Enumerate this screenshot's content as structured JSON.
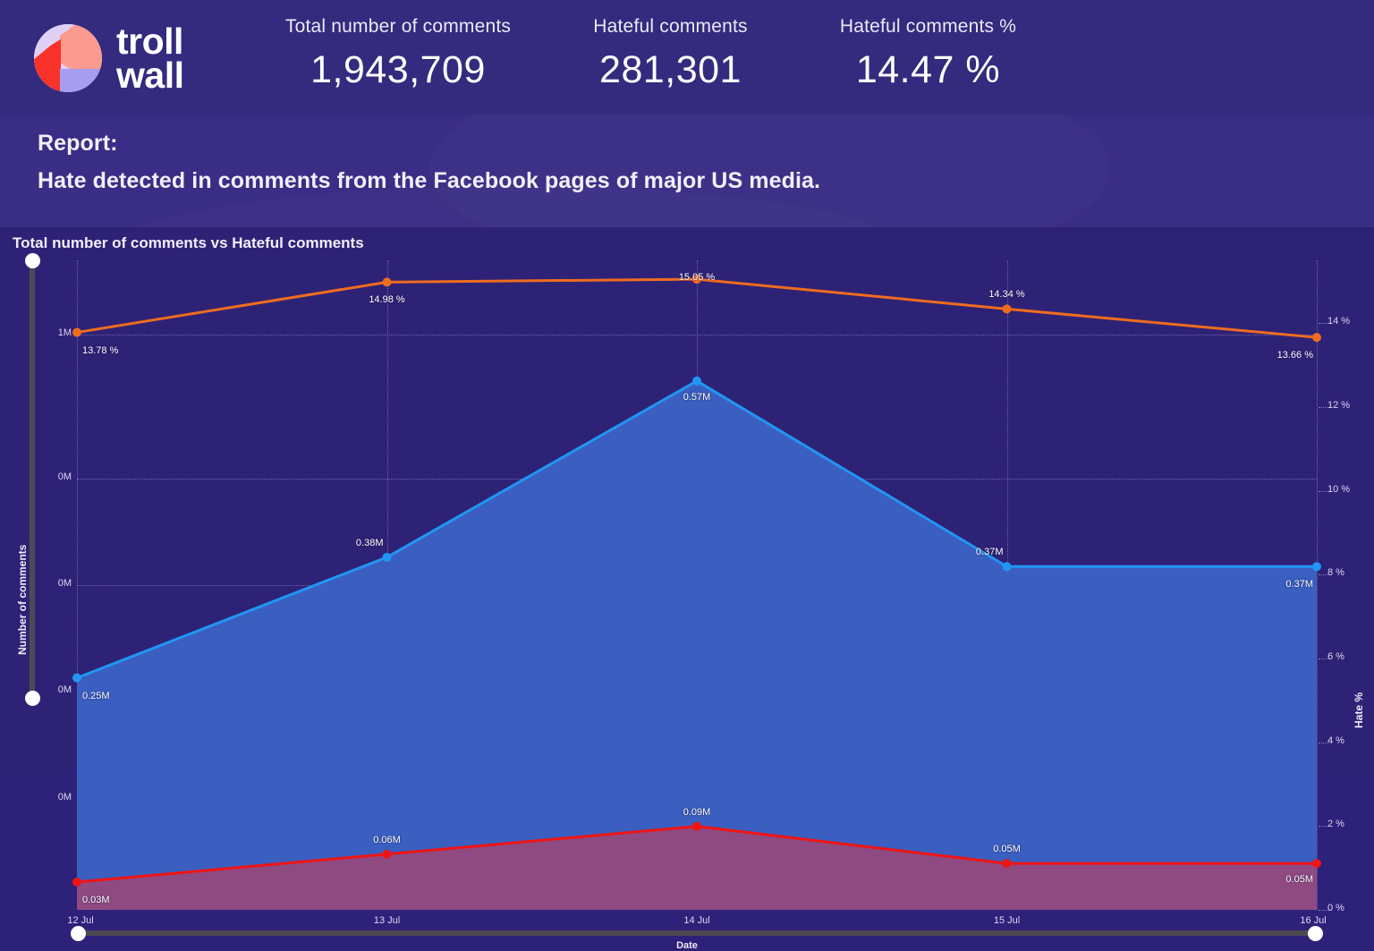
{
  "brand": {
    "logo_line1": "troll",
    "logo_line2": "wall",
    "logo_icon": "trollwall-circle-logo"
  },
  "header": {
    "stats": [
      {
        "label": "Total number of comments",
        "value": "1,943,709"
      },
      {
        "label": "Hateful comments",
        "value": "281,301"
      },
      {
        "label": "Hateful comments %",
        "value": "14.47 %"
      }
    ]
  },
  "report": {
    "label": "Report:",
    "title": "Hate detected in comments from the Facebook pages of major US media."
  },
  "chart": {
    "title": "Total number of comments vs Hateful comments",
    "y_left_title": "Number of comments",
    "y_right_title": "Hate %",
    "x_title": "Date"
  },
  "colors": {
    "background": "#2d2179",
    "header_background": "#342a7e",
    "report_background": "#3a2d85",
    "chart_background": "#2e2276",
    "total_line": "#2196f3",
    "total_area": "#3a5fc0",
    "hateful_line": "#f01414",
    "hateful_area": "#8e4a81",
    "rate_line": "#ef6c1f",
    "slider_track": "#4f4a52",
    "slider_knob": "#ffffff",
    "grid": "#d2cdf5"
  },
  "chart_data": {
    "type": "line",
    "title": "Total number of comments vs Hateful comments",
    "xlabel": "Date",
    "ylabel": "Number of comments",
    "y2label": "Hate %",
    "grid": true,
    "legend": "none",
    "categories": [
      "12 Jul",
      "13 Jul",
      "14 Jul",
      "15 Jul",
      "16 Jul"
    ],
    "y_left_ticks": [
      "1M",
      "0M",
      "0M",
      "0M",
      "0M"
    ],
    "y_right_ticks": [
      "14 %",
      "12 %",
      "10 %",
      "8 %",
      "6 %",
      "4 %",
      "2 %",
      "0 %"
    ],
    "ylim": [
      0,
      700000
    ],
    "y2lim": [
      0,
      15.5
    ],
    "series": [
      {
        "name": "Total number of comments",
        "axis": "left",
        "color": "#2196f3",
        "fill": "#3a5fc0",
        "values": [
          250000,
          380000,
          570000,
          370000,
          370000
        ],
        "labels": [
          "0.25M",
          "0.38M",
          "0.57M",
          "0.37M",
          "0.37M"
        ]
      },
      {
        "name": "Hateful comments",
        "axis": "left",
        "color": "#f01414",
        "fill": "#8e4a81",
        "values": [
          30000,
          60000,
          90000,
          50000,
          50000
        ],
        "labels": [
          "0.03M",
          "0.06M",
          "0.09M",
          "0.05M",
          "0.05M"
        ]
      },
      {
        "name": "Hate %",
        "axis": "right",
        "color": "#ef6c1f",
        "values": [
          13.78,
          14.98,
          15.05,
          14.34,
          13.66
        ],
        "labels": [
          "13.78 %",
          "14.98 %",
          "15.05 %",
          "14.34 %",
          "13.66 %"
        ]
      }
    ]
  },
  "controls": {
    "vertical_slider": "y-axis-range-slider",
    "horizontal_slider": "x-axis-range-slider"
  }
}
